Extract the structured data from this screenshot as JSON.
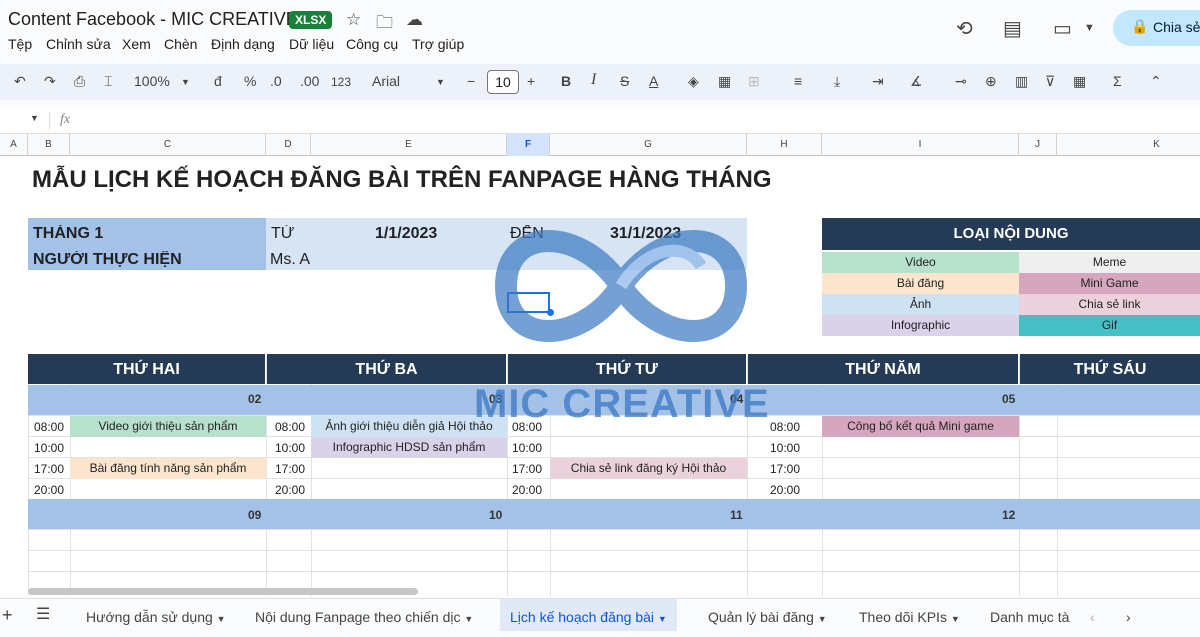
{
  "window": {
    "doc_title": "Content Facebook  - MIC CREATIVE",
    "badge": "XLSX",
    "share_label": "Chia sẻ"
  },
  "menu": [
    "Tệp",
    "Chỉnh sửa",
    "Xem",
    "Chèn",
    "Định dạng",
    "Dữ liệu",
    "Công cụ",
    "Trợ giúp"
  ],
  "toolbar": {
    "zoom": "100%",
    "currency": "đ",
    "percent": "%",
    "dec_less": ".0",
    "dec_more": ".00",
    "number_fmt": "123",
    "font": "Arial",
    "font_size": "10",
    "minus": "−",
    "plus": "+",
    "bold": "B",
    "italic": "I",
    "strike": "S",
    "text_color": "A",
    "sum": "Σ"
  },
  "formula": {
    "fx": "fx"
  },
  "columns": [
    "A",
    "B",
    "C",
    "D",
    "E",
    "F",
    "G",
    "H",
    "I",
    "J",
    "K"
  ],
  "sheet": {
    "title": "MẪU LỊCH KẾ HOẠCH ĐĂNG BÀI TRÊN FANPAGE HÀNG THÁNG",
    "month_label": "THÁNG 1",
    "from_label": "TỪ",
    "from_date": "1/1/2023",
    "to_label": "ĐẾN",
    "to_date": "31/1/2023",
    "owner_label": "NGƯỜI THỰC HIỆN",
    "owner": "Ms. A",
    "legend_title": "LOẠI NỘI DUNG",
    "legend": [
      {
        "label": "Video",
        "color": "#b7e1cd"
      },
      {
        "label": "Meme",
        "color": "#eeeeee"
      },
      {
        "label": "Bài đăng",
        "color": "#fce5cd"
      },
      {
        "label": "Mini Game",
        "color": "#d5a6bd"
      },
      {
        "label": "Ảnh",
        "color": "#cfe2f3"
      },
      {
        "label": "Chia sẻ link",
        "color": "#ead1dc"
      },
      {
        "label": "Infographic",
        "color": "#d9d2e9"
      },
      {
        "label": "Gif",
        "color": "#45c1c6"
      }
    ],
    "days": [
      "THỨ HAI",
      "THỨ BA",
      "THỨ TƯ",
      "THỨ NĂM",
      "THỨ SÁU"
    ],
    "week1_dates": [
      "02",
      "03",
      "04",
      "05"
    ],
    "week2_dates": [
      "09",
      "10",
      "11",
      "12"
    ],
    "times": [
      "08:00",
      "10:00",
      "17:00",
      "20:00"
    ],
    "items": {
      "mon_0800": "Video giới thiệu sản phẩm",
      "mon_1700": "Bài đăng tính năng sản phẩm",
      "tue_0800": "Ảnh giới thiệu diễn giả Hội thảo",
      "tue_1000": "Infographic HDSD sản phẩm",
      "wed_1700": "Chia sẻ link đăng ký Hội thảo",
      "thu_0800": "Công bố kết quả Mini game"
    },
    "watermark": "MIC CREATIVE"
  },
  "tabs": [
    "Hướng dẫn sử dụng",
    "Nội dung Fanpage theo chiến dịc",
    "Lịch kế hoạch đăng bài",
    "Quản lý bài đăng",
    "Theo dõi KPIs",
    "Danh mục tà"
  ]
}
